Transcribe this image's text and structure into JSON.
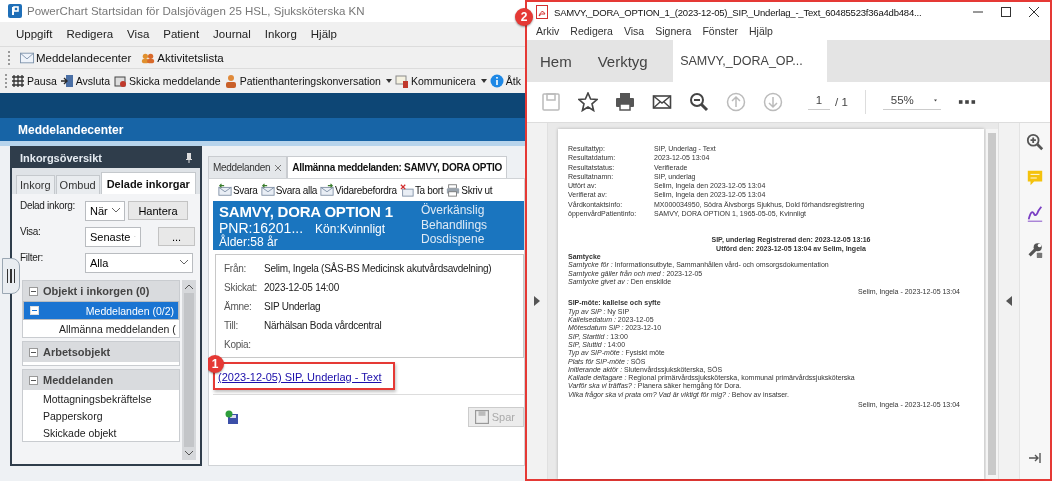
{
  "app": {
    "title": "PowerChart Startsidan för Dalsjövägen 25 HSL, Sjuksköterska KN",
    "menu": [
      "Uppgift",
      "Redigera",
      "Visa",
      "Patient",
      "Journal",
      "Inkorg",
      "Hjälp"
    ],
    "toolbar_1": [
      "Meddelandecenter",
      "Aktivitetslista"
    ],
    "toolbar_2": [
      {
        "label": "Pausa",
        "dropdown": false
      },
      {
        "label": "Avsluta",
        "dropdown": false
      },
      {
        "label": "Skicka meddelande",
        "dropdown": false
      },
      {
        "label": "Patienthanteringskonversation",
        "dropdown": true
      },
      {
        "label": "Kommunicera",
        "dropdown": true
      },
      {
        "label": "Åtk",
        "dropdown": false
      }
    ],
    "section_title": "Meddelandecenter"
  },
  "inbox_panel": {
    "title": "Inkorgsöversikt",
    "tabs": [
      {
        "label": "Inkorg",
        "selected": false
      },
      {
        "label": "Ombud",
        "selected": false
      },
      {
        "label": "Delade inkorgar",
        "selected": true
      }
    ],
    "shared_inbox": {
      "label": "Delad inkorg:",
      "value": "När",
      "button": "Hantera"
    },
    "show": {
      "label": "Visa:",
      "value": "Senaste",
      "button": "..."
    },
    "filter": {
      "label": "Filter:",
      "value": "Alla"
    },
    "groups": [
      {
        "label": "Objekt i inkorgen (0)",
        "expanded": true,
        "children": [
          {
            "label": "Meddelanden (0/2)",
            "selected": true,
            "expanded": true,
            "children": [
              {
                "label": "Allmänna meddelanden (",
                "selected": false
              }
            ]
          }
        ]
      },
      {
        "label": "Arbetsobjekt",
        "expanded": true
      },
      {
        "label": "Meddelanden",
        "expanded": true,
        "children": [
          {
            "label": "Mottagningsbekräftelse",
            "selected": false
          },
          {
            "label": "Papperskorg",
            "selected": false
          },
          {
            "label": "Skickade objekt",
            "selected": false
          }
        ]
      }
    ]
  },
  "message_panel": {
    "tabs": [
      {
        "label": "Meddelanden",
        "selected": false,
        "closable": true
      },
      {
        "label": "Allmänna meddelanden: SAMVY, DORA OPTIO",
        "selected": true,
        "closable": false
      }
    ],
    "actions": [
      "Svara",
      "Svara alla",
      "Vidarebefordra",
      "Ta bort",
      "Skriv ut"
    ],
    "patient": {
      "name": "SAMVY, DORA OPTION 1",
      "pnr": "PNR:16201...",
      "sex": "Kön:Kvinnligt",
      "age": "Ålder:58 år",
      "flags": [
        "Överkänslig",
        "Behandlings",
        "Dosdispene"
      ]
    },
    "fields": [
      {
        "label": "Från:",
        "value": "Selim, Ingela (SÅS-BS Medicinsk akutvårdsavdelning)"
      },
      {
        "label": "Skickat:",
        "value": "2023-12-05 14:00"
      },
      {
        "label": "Ämne:",
        "value": "SIP Underlag"
      },
      {
        "label": "Till:",
        "value": "Närhälsan Boda vårdcentral"
      },
      {
        "label": "Kopia:"
      }
    ],
    "attachment_link": "(2023-12-05) SIP, Underlag - Text",
    "callout": "1",
    "save_button": {
      "label": "Spar",
      "disabled": true
    }
  },
  "pdf_window": {
    "title": "SAMVY,_DORA_OPTION_1_(2023-12-05)_SIP,_Underlag_-_Text_60485523f36a4db484...",
    "callout": "2",
    "menu": [
      "Arkiv",
      "Redigera",
      "Visa",
      "Signera",
      "Fönster",
      "Hjälp"
    ],
    "tabs": [
      {
        "label": "Hem",
        "selected": false
      },
      {
        "label": "Verktyg",
        "selected": false
      },
      {
        "label": "SAMVY,_DORA_OP...",
        "selected": true
      }
    ],
    "page": "1",
    "page_count": "/ 1",
    "zoom": "55%",
    "document": {
      "fields": [
        {
          "label": "Resultattyp:",
          "value": "SIP, Underlag - Text"
        },
        {
          "label": "Resultatdatum:",
          "value": "2023-12-05 13:04"
        },
        {
          "label": "Resultatstatus:",
          "value": "Verifierade"
        },
        {
          "label": "Resultatnamn:",
          "value": "SIP, underlag"
        },
        {
          "label": "Utfört av:",
          "value": "Selim, Ingela den 2023-12-05 13:04"
        },
        {
          "label": "Verifierat av:",
          "value": "Selim, Ingela den 2023-12-05 13:04"
        },
        {
          "label": "Vårdkontaktsinfo:",
          "value": "MX000034950, Södra Älvsborgs Sjukhus, Dold förhandsregistrering"
        },
        {
          "label": "öppenvårdPatientinfo:",
          "value": "SAMVY, DORA OPTION 1,  1965-05-05,  Kvinnligt"
        }
      ],
      "summary": [
        "SIP, underlag Registrerad den:  2023-12-05 13:16",
        "Utförd den:  2023-12-05 13:04  av Selim, Ingela"
      ],
      "sections": [
        {
          "title": "Samtycke",
          "lines": [
            "*Samtycke för :*  Informationsutbyte, Sammanhållen vård- och omsorgsdokumentation",
            "*Samtycke gäller från och med :*  2023-12-05",
            "*Samtycke givet av :*  Den enskilde"
          ],
          "signature": "Selim, Ingela - 2023-12-05 13:04"
        },
        {
          "title": "SIP-möte: kallelse och syfte",
          "lines": [
            "*Typ av SIP :*  Ny SIP",
            "*Kallelsedatum :*  2023-12-05",
            "*Mötesdatum SIP :*  2023-12-10",
            "*SIP, Starttid :*  13:00",
            "*SIP, Sluttid :*  14:00",
            "*Typ av SIP-möte :*  Fysiskt möte",
            "*Plats för SIP-möte :*  SÖS",
            "*Initierande aktör :*  Slutenvårdssjuksköterska, SÖS",
            "*Kallade deltagare :*  Regional primärvårdssjuksköterska, kommunal primärvårdssjuksköterska",
            "*Varför ska vi träffas? :*  Planera säker hemgång för Dora.",
            "*Vilka frågor ska vi prata om? Vad är viktigt för mig? :*  Behov av insatser."
          ],
          "signature": "Selim, Ingela - 2023-12-05 13:04"
        }
      ]
    }
  }
}
